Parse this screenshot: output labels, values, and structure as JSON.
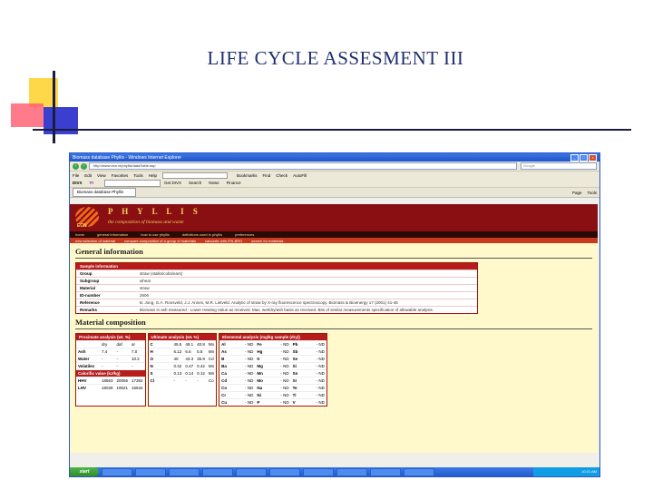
{
  "slide_title": "LIFE CYCLE ASSESMENT III",
  "browser": {
    "window_title": "Biomass database Phyllis - Windows Internet Explorer",
    "address": "http://www.ecn.nl/phyllis/dataTable.asp",
    "search_placeholder": "Google",
    "menu": [
      "File",
      "Edit",
      "View",
      "Favorites",
      "Tools",
      "Help"
    ],
    "toolbar": [
      "Bookmarks",
      "Find",
      "Check",
      "AutoFill",
      "Send to"
    ],
    "toolbar2": [
      "Get DIVX",
      "Search",
      "News",
      "Finance"
    ],
    "tab_label": "Biomass database Phyllis",
    "tab_tools": [
      "Page",
      "Tools"
    ]
  },
  "site": {
    "title": "P H Y L L I S",
    "subtitle": "the composition of biomass and waste",
    "logo_text": "ECN",
    "nav_primary": [
      "home",
      "general information",
      "how to use phyllis",
      "definitions used in phyllis",
      "preferences"
    ],
    "nav_secondary": [
      "new selection of material",
      "compare composition of a group of materials",
      "calculate with IPA-BRO",
      "search for materials"
    ]
  },
  "general_info": {
    "heading": "General information",
    "box_title": "Sample information",
    "rows": [
      {
        "k": "Group",
        "v": "straw (stalks/cobs/ears)"
      },
      {
        "k": "Subgroup",
        "v": "wheat"
      },
      {
        "k": "Material",
        "v": "straw"
      },
      {
        "k": "ID-number",
        "v": "2606"
      },
      {
        "k": "Reference",
        "v": "B. Jong, G.A. Ronsveld, J.J. Annes, M.R. Lietveld. Analytic of straw by X-ray fluorescence spectroscopy. Biomass & Bioenergy 17 (2001) 41-46"
      },
      {
        "k": "Remarks",
        "v": "Biomass in ash measured - Lower Heating Value as received. Max. wet/dry/ash basis as received. Bits of similar measurements specification of allowable analysis."
      }
    ]
  },
  "material_comp": {
    "heading": "Material composition",
    "prox_title": "Proximate analysis (wt. %)",
    "ult_title": "Ultimate analysis (wt. %)",
    "elem_title": "Elemental analysis (mg/kg sample (dry))",
    "cal_title": "Calorific value (kJ/kg)",
    "prox_cols": [
      "",
      "dry",
      "daf",
      "ar"
    ],
    "prox_rows": [
      [
        "Ash",
        "7.4",
        "-",
        "7.0"
      ],
      [
        "Water",
        "-",
        "-",
        "10.2"
      ],
      [
        "Volatiles",
        "-",
        "-",
        "-"
      ]
    ],
    "cal_rows": [
      [
        "HHV",
        "18563",
        "20055",
        "17382"
      ],
      [
        "LHV",
        "18028",
        "19521",
        "15634"
      ]
    ],
    "ult_rows": [
      [
        "H",
        "C",
        "45.5",
        "49.1",
        "40.8",
        "Mo"
      ],
      [
        "H",
        "H",
        "6.12",
        "6.6",
        "5.5",
        "Mn"
      ],
      [
        "H",
        "O",
        "40",
        "43.3",
        "35.9",
        "Cd"
      ],
      [
        "H",
        "N",
        "0.42",
        "0.47",
        "0.42",
        "Mn"
      ],
      [
        "H",
        "S",
        "0.13",
        "0.14",
        "0.12",
        "Mn"
      ],
      [
        "H",
        "Cl",
        "-",
        "-",
        "-",
        "Co"
      ]
    ],
    "elem_rows": [
      [
        "Al",
        "- ND",
        "Fe",
        "- ND",
        "Pb",
        "- ND"
      ],
      [
        "As",
        "- ND",
        "Hg",
        "- ND",
        "Sb",
        "- ND"
      ],
      [
        "B",
        "- ND",
        "K",
        "- ND",
        "Se",
        "- ND"
      ],
      [
        "Ba",
        "- ND",
        "Mg",
        "- ND",
        "Si",
        "- ND"
      ],
      [
        "Ca",
        "- ND",
        "Mn",
        "- ND",
        "Sn",
        "- ND"
      ],
      [
        "Cd",
        "- ND",
        "Mo",
        "- ND",
        "Sr",
        "- ND"
      ],
      [
        "Co",
        "- ND",
        "Na",
        "- ND",
        "Te",
        "- ND"
      ],
      [
        "Cr",
        "- ND",
        "Ni",
        "- ND",
        "Ti",
        "- ND"
      ],
      [
        "Cu",
        "- ND",
        "P",
        "- ND",
        "V",
        "- ND"
      ]
    ]
  },
  "taskbar": {
    "start_label": "start",
    "tray_time": "10:21 AM"
  }
}
